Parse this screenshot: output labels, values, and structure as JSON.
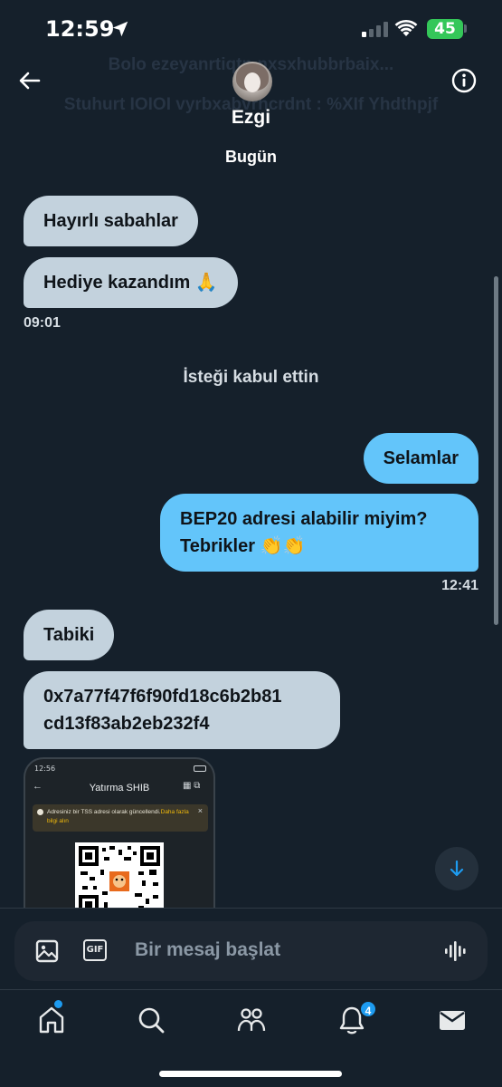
{
  "status_bar": {
    "time": "12:59",
    "battery": "45",
    "icons": [
      "location-arrow-icon",
      "cellular-signal-icon",
      "wifi-icon",
      "battery-icon"
    ]
  },
  "header": {
    "faded_banner": [
      "Bolo ezeyanrtiqtn nxsxhubbrbaix...",
      "Stuhurt IOIOI vyrbxabvrhcrdnt : %XIf Yhdthpjf"
    ],
    "contact_name": "Ezgi",
    "date_label": "Bugün",
    "icons": [
      "back-arrow-icon",
      "info-icon"
    ]
  },
  "messages": [
    {
      "side": "in",
      "text": "Hayırlı sabahlar"
    },
    {
      "side": "in",
      "text": "Hediye kazandım 🙏"
    },
    {
      "timestamp": "09:01"
    },
    {
      "system": "İsteği kabul ettin"
    },
    {
      "side": "out",
      "text": "Selamlar"
    },
    {
      "side": "out",
      "lines": [
        "BEP20 adresi alabilir miyim?",
        "Tebrikler 👏👏"
      ]
    },
    {
      "timestamp": "12:41"
    },
    {
      "side": "in",
      "text": "Tabiki"
    },
    {
      "side": "in",
      "lines": [
        "0x7a77f47f6f90fd18c6b2b81",
        "cd13f83ab2eb232f4"
      ]
    }
  ],
  "attachment": {
    "status_time": "12:56",
    "title": "Yatırma SHIB",
    "notice_text": "Adresiniz bir TSS adresi olarak güncellendi.",
    "notice_link": "Daha fazla bilgi alın"
  },
  "composer": {
    "placeholder": "Bir mesaj başlat",
    "gif_label": "GIF",
    "icons": [
      "image-icon",
      "gif-icon",
      "voice-message-icon"
    ]
  },
  "tabbar": {
    "tabs": [
      "home",
      "search",
      "communities",
      "notifications",
      "messages"
    ],
    "notification_count": "4",
    "accent_color": "#1d9bf0"
  },
  "colors": {
    "background": "#15202b",
    "incoming_bubble": "#c3d2dd",
    "outgoing_bubble": "#63c5fa"
  }
}
